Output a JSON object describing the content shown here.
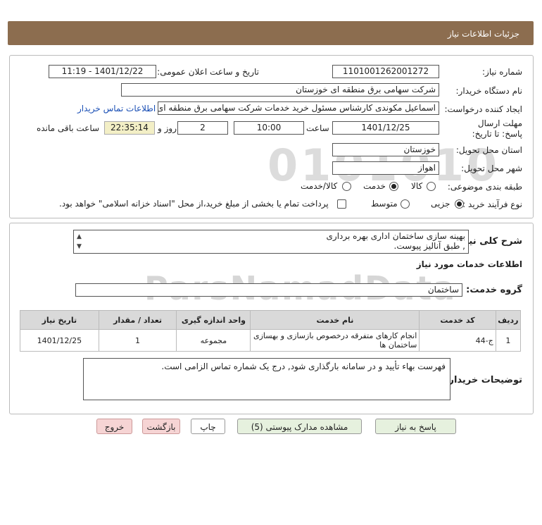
{
  "header": {
    "title": "جزئیات اطلاعات نیاز"
  },
  "form": {
    "need_number_label": "شماره نیاز:",
    "need_number_value": "1101001262001272",
    "announce_label": "تاریخ و ساعت اعلان عمومی:",
    "announce_value": "1401/12/22 - 11:19",
    "buyer_org_label": "نام دستگاه خریدار:",
    "buyer_org_value": "شرکت سهامی برق منطقه ای خوزستان",
    "creator_label": "ایجاد کننده درخواست:",
    "creator_value": "اسماعیل مکوندی کارشناس مسئول خرید خدمات شرکت سهامی برق منطقه ای",
    "contact_link": "اطلاعات تماس خریدار",
    "deadline_label": "مهلت ارسال پاسخ: تا تاریخ:",
    "deadline_date": "1401/12/25",
    "time_label": "ساعت",
    "deadline_time": "10:00",
    "days_value": "2",
    "days_label": "روز و",
    "remaining_time": "22:35:14",
    "remaining_label": "ساعت باقی مانده",
    "province_label": "استان محل تحویل:",
    "province_value": "خوزستان",
    "city_label": "شهر محل تحویل:",
    "city_value": "اهواز",
    "category_label": "طبقه بندی موضوعی:",
    "category_options": [
      "کالا",
      "خدمت",
      "کالا/خدمت"
    ],
    "category_selected": "خدمت",
    "process_label": "نوع فرآیند خرید :",
    "process_options": [
      "جزیی",
      "متوسط"
    ],
    "process_selected": "جزیی",
    "treasury_note": "پرداخت تمام یا بخشی از مبلغ خرید،از محل \"اسناد خزانه اسلامی\" خواهد بود."
  },
  "summary": {
    "label": "شرح کلی نیاز:",
    "line1": "بهینه سازی ساختمان اداری بهره برداری",
    "line2": ", طبق آنالیز پیوست."
  },
  "services": {
    "section_title": "اطلاعات خدمات مورد نیاز",
    "group_label": "گروه خدمت:",
    "group_value": "ساختمان",
    "columns": [
      "ردیف",
      "کد خدمت",
      "نام خدمت",
      "واحد اندازه گیری",
      "تعداد / مقدار",
      "تاریخ نیاز"
    ],
    "rows": [
      {
        "row": "1",
        "code": "ج-44",
        "name": "انجام کارهای متفرقه درخصوص بازسازی و بهسازی ساختمان ها",
        "unit": "مجموعه",
        "qty": "1",
        "date": "1401/12/25"
      }
    ]
  },
  "buyer_notes": {
    "label": "توضیحات خریدار:",
    "text": "فهرست بهاء تأیید و در سامانه بارگذاری شود, درج یک شماره تماس الزامی است."
  },
  "buttons": {
    "reply": "پاسخ به نیاز",
    "attachments": "مشاهده مدارک پیوستی (5)",
    "print": "چاپ",
    "back": "بازگشت",
    "exit": "خروج"
  },
  "watermark": {
    "number": "0101010",
    "brand": "ParsNamadData",
    "phone": "۰۲۱-۸۸۳۴۹۶۷۰-۵"
  }
}
